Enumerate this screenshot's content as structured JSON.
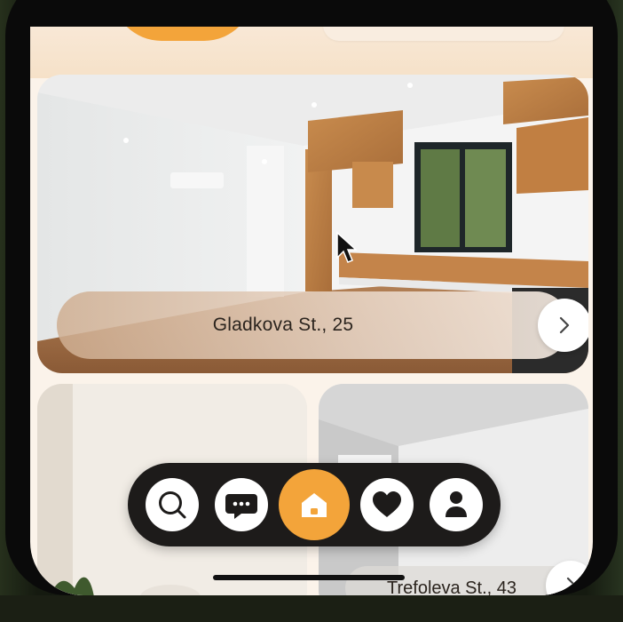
{
  "listings": [
    {
      "address": "Gladkova St., 25"
    },
    {
      "address": ""
    },
    {
      "address": "Trefoleva St., 43"
    }
  ],
  "nav": {
    "items": [
      {
        "name": "search",
        "icon": "search-icon"
      },
      {
        "name": "messages",
        "icon": "chat-icon"
      },
      {
        "name": "home",
        "icon": "home-icon",
        "active": true
      },
      {
        "name": "favorites",
        "icon": "heart-icon"
      },
      {
        "name": "profile",
        "icon": "user-icon"
      }
    ]
  },
  "colors": {
    "accent": "#f3a43a",
    "navbar": "#1d1b1a",
    "background": "#fbf3ea"
  },
  "icons": {
    "arrow": "chevron-right-icon",
    "cursor": "mouse-pointer"
  }
}
